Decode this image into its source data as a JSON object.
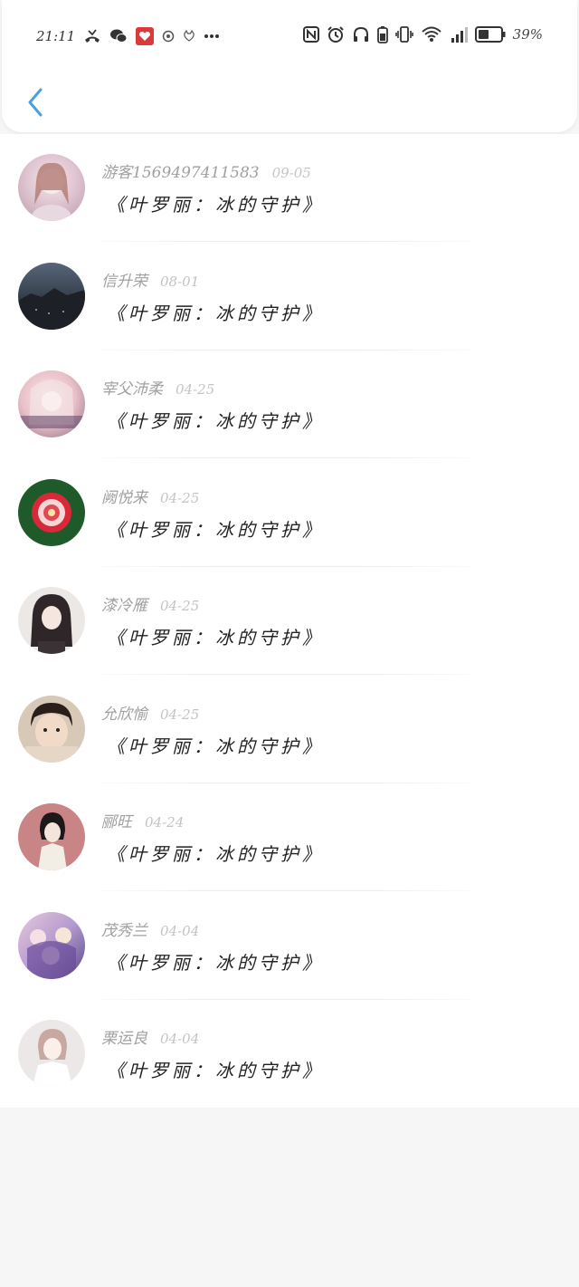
{
  "status_bar": {
    "time": "21:11",
    "battery_percent": "39%",
    "left_icons": [
      "missed-call-icon",
      "wechat-icon",
      "app-icon",
      "camera-app-icon",
      "cat-app-icon",
      "more-dots-icon"
    ],
    "right_icons": [
      "nfc-icon",
      "alarm-icon",
      "headphones-icon",
      "battery-saver-icon",
      "vibrate-icon",
      "wifi-icon",
      "signal-icon",
      "battery-icon"
    ]
  },
  "header": {
    "back_icon": "chevron-left-icon",
    "accent_color": "#4a9fe0"
  },
  "comments": [
    {
      "user": "游客15694974115​83",
      "date": "09-05",
      "title": "《叶罗丽：冰的守护》",
      "avatar_colors": [
        "#e8d5e0",
        "#b89aa8"
      ]
    },
    {
      "user": "信升荣",
      "date": "08-01",
      "title": "《叶罗丽：冰的守护》",
      "avatar_colors": [
        "#3a4452",
        "#1c1f26"
      ]
    },
    {
      "user": "宰父沛柔",
      "date": "04-25",
      "title": "《叶罗丽：冰的守护》",
      "avatar_colors": [
        "#f2d2d8",
        "#8f6a86"
      ]
    },
    {
      "user": "阙悦来",
      "date": "04-25",
      "title": "《叶罗丽：冰的守护》",
      "avatar_colors": [
        "#1e5a2a",
        "#d9283a"
      ]
    },
    {
      "user": "漆冷雁",
      "date": "04-25",
      "title": "《叶罗丽：冰的守护》",
      "avatar_colors": [
        "#e6e2e0",
        "#3a3234"
      ]
    },
    {
      "user": "允欣愉",
      "date": "04-25",
      "title": "《叶罗丽：冰的守护》",
      "avatar_colors": [
        "#d8c2b0",
        "#4a3a30"
      ]
    },
    {
      "user": "郦旺",
      "date": "04-24",
      "title": "《叶罗丽：冰的守护》",
      "avatar_colors": [
        "#c98486",
        "#2a2020"
      ]
    },
    {
      "user": "茂秀兰",
      "date": "04-04",
      "title": "《叶罗丽：冰的守护》",
      "avatar_colors": [
        "#c8b4dc",
        "#5a4a86"
      ]
    },
    {
      "user": "栗运良",
      "date": "04-04",
      "title": "《叶罗丽：冰的守护》",
      "avatar_colors": [
        "#ece6e6",
        "#c8a8a0"
      ]
    }
  ]
}
